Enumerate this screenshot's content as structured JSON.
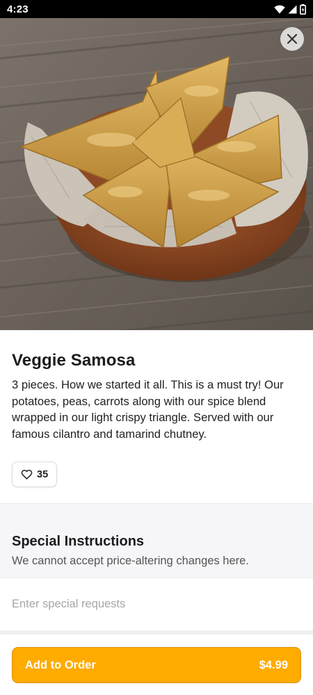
{
  "status_bar": {
    "time": "4:23"
  },
  "item": {
    "title": "Veggie Samosa",
    "description": "3 pieces. How we started it all. This is a must try! Our potatoes, peas, carrots along with our spice blend wrapped in our light crispy triangle. Served with our famous cilantro and tamarind chutney.",
    "likes": "35"
  },
  "instructions": {
    "title": "Special Instructions",
    "subtitle": "We cannot accept price-altering changes here.",
    "placeholder": "Enter special requests"
  },
  "footer": {
    "add_label": "Add to Order",
    "price": "$4.99"
  },
  "icons": {
    "close": "close-icon",
    "like": "heart-icon",
    "wifi": "wifi-icon",
    "signal": "signal-icon",
    "battery": "battery-icon"
  },
  "colors": {
    "accent": "#ffab00",
    "status_bar": "#000000"
  }
}
